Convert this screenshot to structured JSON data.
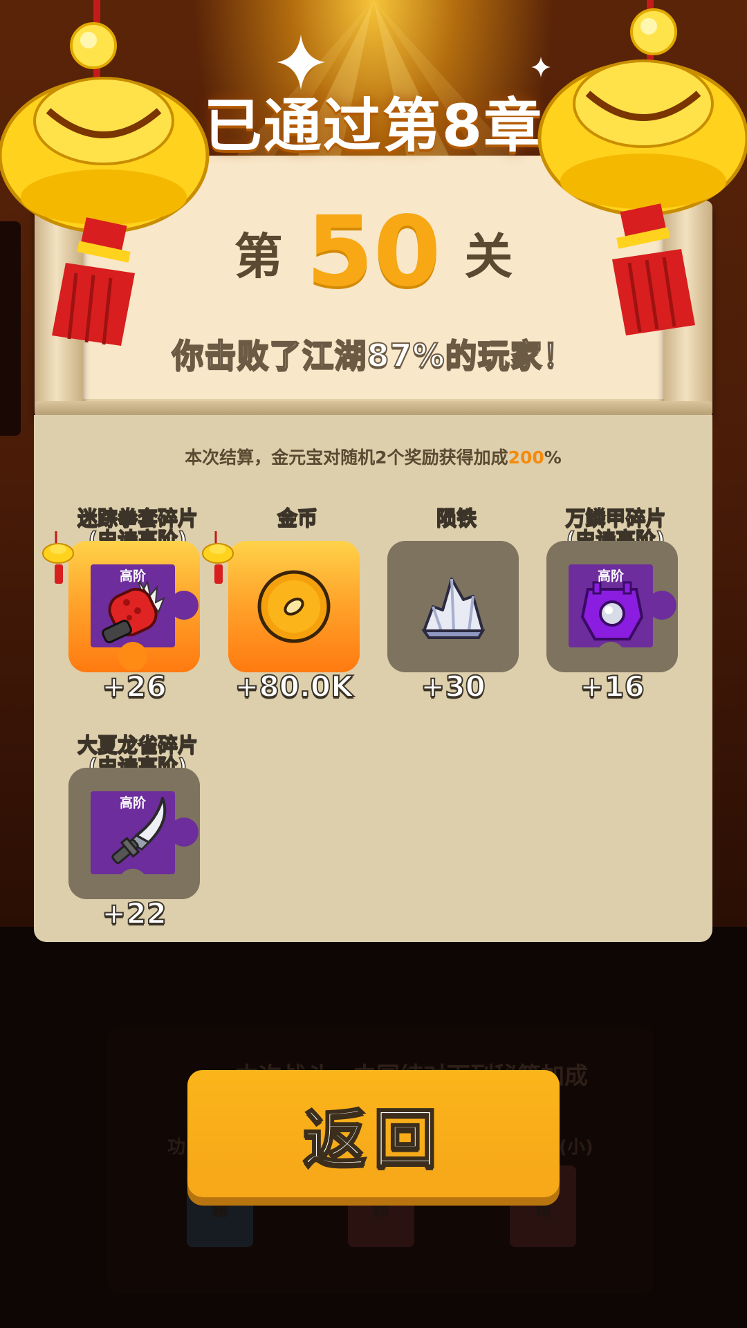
{
  "header": {
    "chapter_title": "已通过第8章"
  },
  "result": {
    "level_prefix": "第",
    "level_number": "50",
    "level_suffix": "关",
    "defeat_text": "你击败了江湖87%的玩家！"
  },
  "bonus": {
    "text_before": "本次结算，金元宝对随机2个奖励获得加成",
    "value": "200",
    "text_after": "%"
  },
  "rewards": [
    {
      "name_line1": "迷踪拳套碎片",
      "name_line2": "(史诗高阶)",
      "tier": "高阶",
      "amount": "+26",
      "icon": "red-gauntlet-icon",
      "boosted": true
    },
    {
      "name_line1": "",
      "name_line2": "金币",
      "tier": "",
      "amount": "+80.0K",
      "icon": "gold-coin-icon",
      "boosted": true
    },
    {
      "name_line1": "",
      "name_line2": "陨铁",
      "tier": "",
      "amount": "+30",
      "icon": "meteor-iron-crystal-icon",
      "boosted": false
    },
    {
      "name_line1": "万鳞甲碎片",
      "name_line2": "(史诗高阶)",
      "tier": "高阶",
      "amount": "+16",
      "icon": "purple-armor-icon",
      "boosted": false
    },
    {
      "name_line1": "大夏龙雀碎片",
      "name_line2": "(史诗高阶)",
      "tier": "高阶",
      "amount": "+22",
      "icon": "saber-blade-icon",
      "boosted": false
    }
  ],
  "background_panel": {
    "text": "本次战斗，中国结对下列秘籍加成",
    "label_left": "功",
    "label_right": "(小)",
    "book_label": "籍"
  },
  "actions": {
    "return_label": "返回"
  },
  "colors": {
    "accent_orange": "#f7a814",
    "button_yellow": "#f7a919",
    "panel_beige": "#ddcfac",
    "scroll_paper": "#f8e7c8",
    "epic_purple": "#6d2d9c"
  }
}
